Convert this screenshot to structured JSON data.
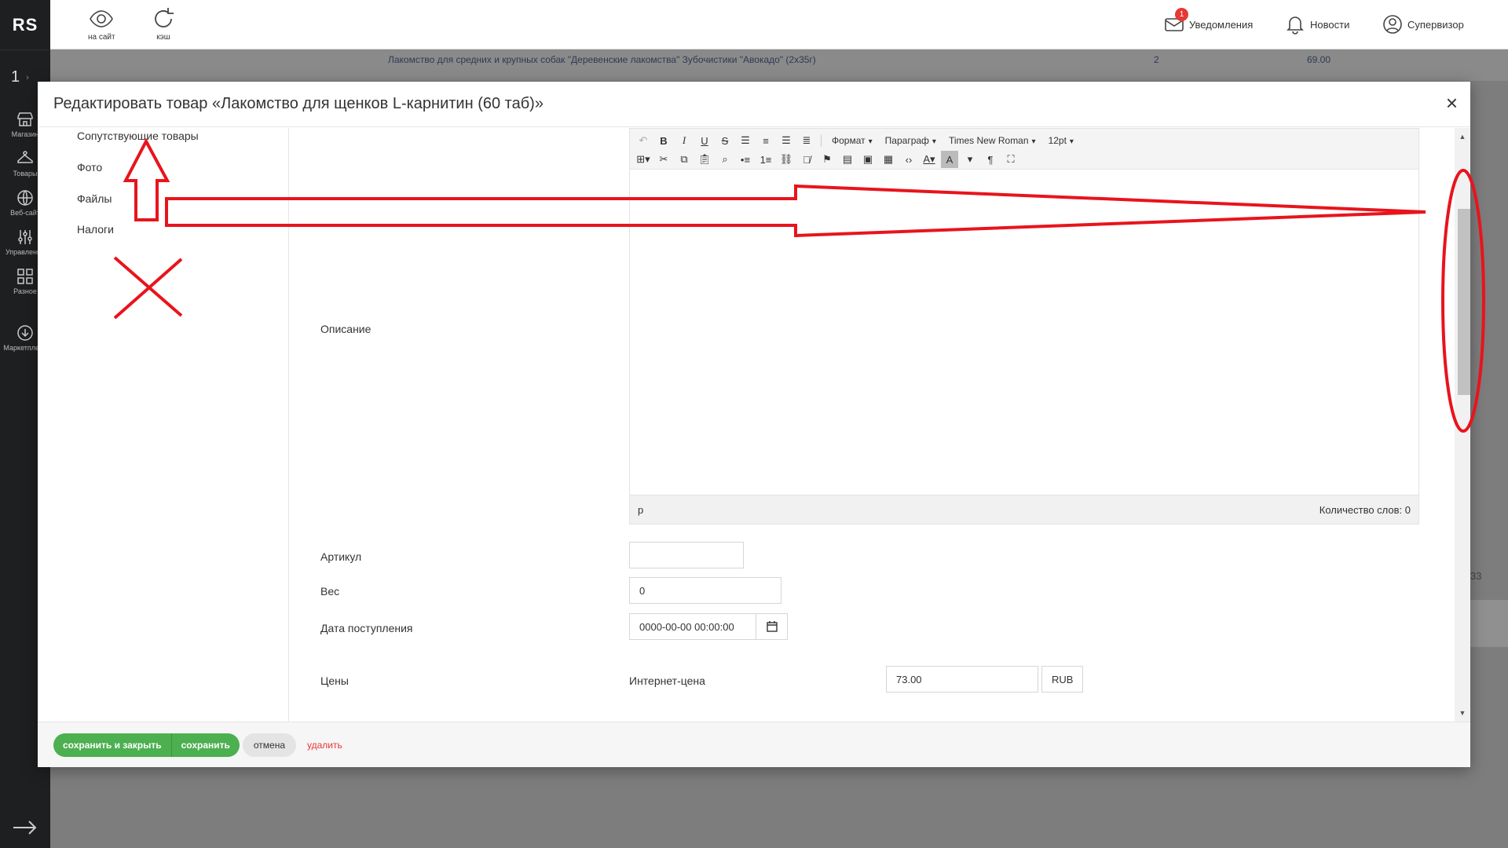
{
  "app": {
    "logo": "RS",
    "site_number": "1"
  },
  "rail": [
    {
      "label": "Магазин",
      "icon": "shop-icon"
    },
    {
      "label": "Товары",
      "icon": "hanger-icon"
    },
    {
      "label": "Веб-сайт",
      "icon": "globe-icon"
    },
    {
      "label": "Управление",
      "icon": "sliders-icon"
    },
    {
      "label": "Разное",
      "icon": "grid-icon"
    },
    {
      "label": "Маркетплейс",
      "icon": "download-icon"
    }
  ],
  "topbar": {
    "to_site": "на сайт",
    "cache": "кэш",
    "notifications": "Уведомления",
    "notifications_count": "1",
    "news": "Новости",
    "user": "Супервизор"
  },
  "background": {
    "row1": "Лакомство для средних и крупных собак \"Деревенские лакомства\" Зубочистики \"Авокадо\" (2x35г)",
    "row1_qty": "2",
    "row1_price": "69.00",
    "side_value": "33"
  },
  "modal": {
    "title": "Редактировать товар «Лакомство для щенков L-карнитин (60 таб)»",
    "close": "×",
    "tabs": [
      "Сопутствующие товары",
      "Фото",
      "Файлы",
      "Налоги"
    ],
    "labels": {
      "description": "Описание",
      "article": "Артикул",
      "weight": "Вес",
      "arrival_date": "Дата поступления",
      "prices": "Цены",
      "internet_price": "Интернет-цена"
    },
    "values": {
      "article": "",
      "weight": "0",
      "arrival_date": "0000-00-00 00:00:00",
      "internet_price": "73.00",
      "currency": "RUB"
    },
    "editor": {
      "format": "Формат",
      "paragraph": "Параграф",
      "font": "Times New Roman",
      "size": "12pt",
      "status_path": "p",
      "word_count": "Количество слов: 0"
    },
    "footer": {
      "save_close": "сохранить и закрыть",
      "save": "сохранить",
      "cancel": "отмена",
      "delete": "удалить"
    }
  },
  "colors": {
    "accent_green": "#4caf50",
    "danger": "#e53935",
    "annotation": "#e8141c"
  }
}
